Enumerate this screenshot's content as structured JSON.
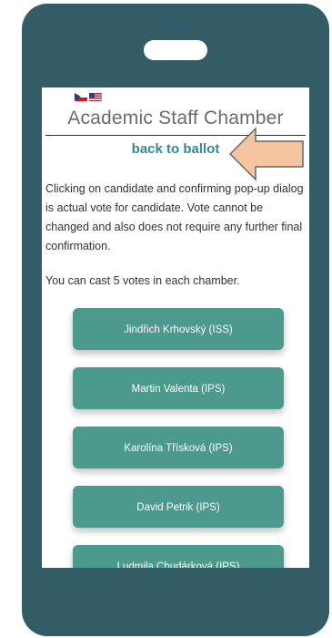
{
  "languages": [
    {
      "code": "cz",
      "icon": "czech-flag-icon"
    },
    {
      "code": "en",
      "icon": "us-flag-icon"
    }
  ],
  "page": {
    "chamber_title": "Academic Staff Chamber",
    "back_link": "back to ballot",
    "info_text": "Clicking on candidate and confirming pop-up dialog is actual vote for candidate. Vote cannot be changed and also does not require any further final confirmation.",
    "votes_note": "You can cast 5 votes in each chamber."
  },
  "candidates": [
    {
      "label": "Jindřich Krhovský (ISS)"
    },
    {
      "label": "Martin Valenta (IPS)"
    },
    {
      "label": "Karolína Třísková (IPS)"
    },
    {
      "label": "David Petrik (IPS)"
    },
    {
      "label": "Ludmila Chudárková (IPS)"
    }
  ],
  "colors": {
    "phone_frame": "#335c67",
    "button": "#4b9a8d",
    "link": "#2e8b98",
    "arrow_fill": "#f7c4a0",
    "arrow_stroke": "#666666"
  }
}
